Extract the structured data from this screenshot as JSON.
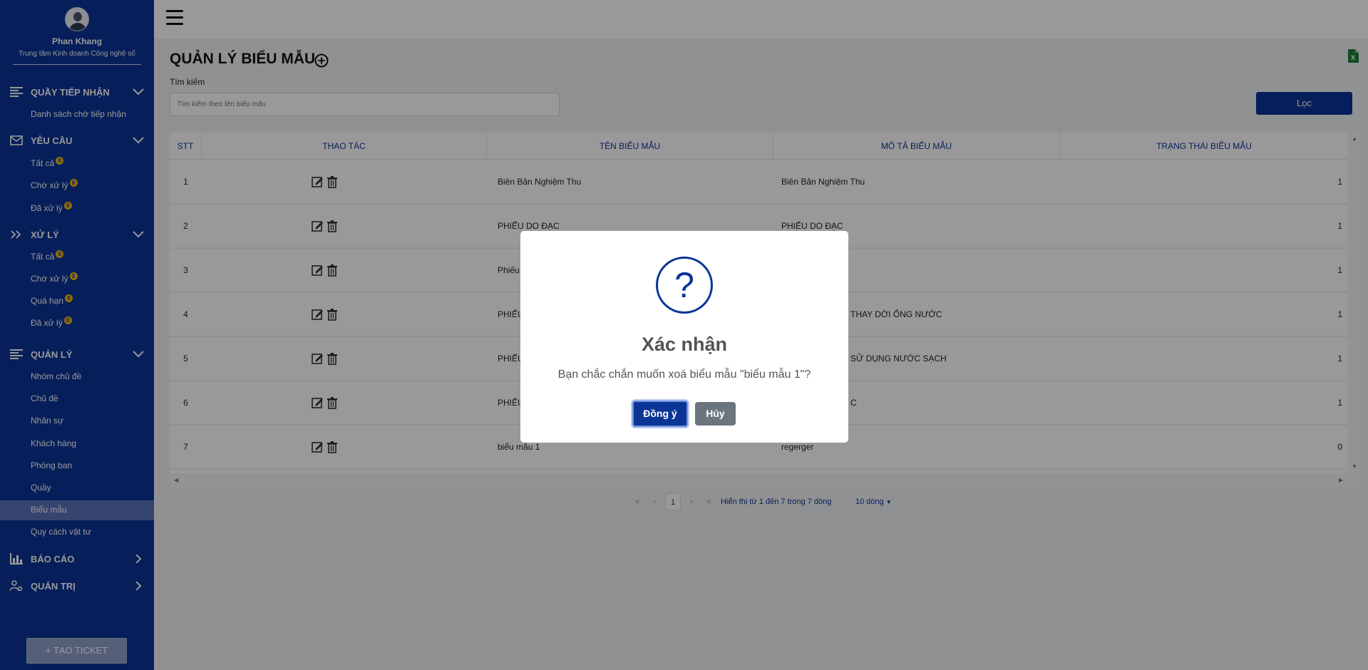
{
  "profile": {
    "name": "Phan Khang",
    "org": "Trung tâm Kinh doanh Công nghệ số"
  },
  "sidebar": {
    "groups": [
      {
        "label": "QUẦY TIẾP NHẬN",
        "icon": "list-icon",
        "expanded": true,
        "items": [
          {
            "label": "Danh sách chờ tiếp nhận"
          }
        ]
      },
      {
        "label": "YÊU CẦU",
        "icon": "mail-icon",
        "expanded": true,
        "items": [
          {
            "label": "Tất cả",
            "badge": "0"
          },
          {
            "label": "Chờ xử lý",
            "badge": "0"
          },
          {
            "label": "Đã xử lý",
            "badge": "0"
          }
        ]
      },
      {
        "label": "XỬ LÝ",
        "icon": "double-chevron-icon",
        "expanded": true,
        "items": [
          {
            "label": "Tất cả",
            "badge": "0"
          },
          {
            "label": "Chờ xử lý",
            "badge": "0"
          },
          {
            "label": "Quá hạn",
            "badge": "0"
          },
          {
            "label": "Đã xử lý",
            "badge": "0"
          }
        ]
      },
      {
        "label": "QUẢN LÝ",
        "icon": "list-icon",
        "expanded": true,
        "items": [
          {
            "label": "Nhóm chủ đề"
          },
          {
            "label": "Chủ đề"
          },
          {
            "label": "Nhân sự"
          },
          {
            "label": "Khách hàng"
          },
          {
            "label": "Phòng ban"
          },
          {
            "label": "Quầy"
          },
          {
            "label": "Biểu mẫu",
            "active": true
          },
          {
            "label": "Quy cách vật tư"
          }
        ]
      },
      {
        "label": "BÁO CÁO",
        "icon": "bar-chart-icon",
        "expanded": false,
        "items": []
      },
      {
        "label": "QUẢN TRỊ",
        "icon": "user-settings-icon",
        "expanded": false,
        "items": []
      }
    ],
    "create_button": "+ TẠO TICKET"
  },
  "page": {
    "title": "QUẢN LÝ BIỂU MẪU",
    "search_label": "Tìm kiếm",
    "search_placeholder": "Tìm kiếm theo tên biểu mẫu",
    "filter_button": "Lọc"
  },
  "table": {
    "columns": [
      "STT",
      "THAO TÁC",
      "TÊN BIỂU MẪU",
      "MÔ TẢ BIỂU MẪU",
      "TRẠNG THÁI BIỂU MẪU"
    ],
    "rows": [
      {
        "stt": "1",
        "name": "Biên Bản Nghiệm Thu",
        "desc": "Biên Bản Nghiệm Thu",
        "status": "1"
      },
      {
        "stt": "2",
        "name": "PHIẾU DO ĐẠC",
        "desc": "PHIẾU DO ĐẠC",
        "status": "1"
      },
      {
        "stt": "3",
        "name": "Phiếu",
        "desc": "",
        "status": "1"
      },
      {
        "stt": "4",
        "name": "PHIẾU",
        "desc": "THAY DỜI ỐNG NƯỚC",
        "status": "1"
      },
      {
        "stt": "5",
        "name": "PHIẾU",
        "desc": "SỬ DỤNG NƯỚC SẠCH",
        "status": "1"
      },
      {
        "stt": "6",
        "name": "PHIẾU",
        "desc": "C",
        "status": "1"
      },
      {
        "stt": "7",
        "name": "biểu mẫu 1",
        "desc": "regerger",
        "status": "0"
      }
    ]
  },
  "pagination": {
    "first": "«",
    "prev": "‹",
    "page": "1",
    "next": "›",
    "last": "»",
    "info": "Hiển thị từ 1 đến 7 trong 7 dòng",
    "page_size": "10 dòng"
  },
  "modal": {
    "icon": "question-icon",
    "title": "Xác nhận",
    "message": "Bạn chắc chắn muốn xoá biểu mẫu \"biểu mẫu 1\"?",
    "confirm": "Đồng ý",
    "cancel": "Hủy"
  }
}
